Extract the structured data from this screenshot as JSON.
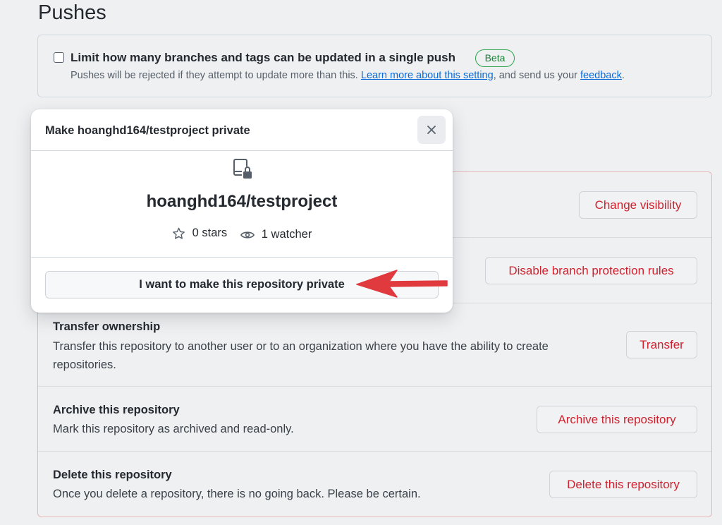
{
  "pushes": {
    "title": "Pushes",
    "checkbox_label": "Limit how many branches and tags can be updated in a single push",
    "badge": "Beta",
    "desc_pre": "Pushes will be rejected if they attempt to update more than this. ",
    "learn_more_link": "Learn more about this setting",
    "desc_mid": ", and send us your ",
    "feedback_link": "feedback",
    "desc_post": "."
  },
  "modal": {
    "title": "Make hoanghd164/testproject private",
    "close_icon": "x-icon",
    "repo_icon": "repo-locked-icon",
    "repo_name": "hoanghd164/testproject",
    "stars": "0 stars",
    "watchers": "1 watcher",
    "confirm_button": "I want to make this repository private"
  },
  "danger_zone": {
    "change_visibility_button": "Change visibility",
    "disable_protection_button": "Disable branch protection rules",
    "transfer": {
      "title": "Transfer ownership",
      "desc_line1": "Transfer this repository to another user or to an organization where you have the ability to create",
      "desc_line2": "repositories.",
      "button": "Transfer"
    },
    "archive": {
      "title": "Archive this repository",
      "desc": "Mark this repository as archived and read-only.",
      "button": "Archive this repository"
    },
    "delete": {
      "title": "Delete this repository",
      "desc": "Once you delete a repository, there is no going back. Please be certain.",
      "button": "Delete this repository"
    }
  },
  "colors": {
    "danger_text": "#cf222e",
    "link": "#0969da",
    "beta_green": "#1a7f37",
    "annotation_arrow": "#e0393e"
  }
}
